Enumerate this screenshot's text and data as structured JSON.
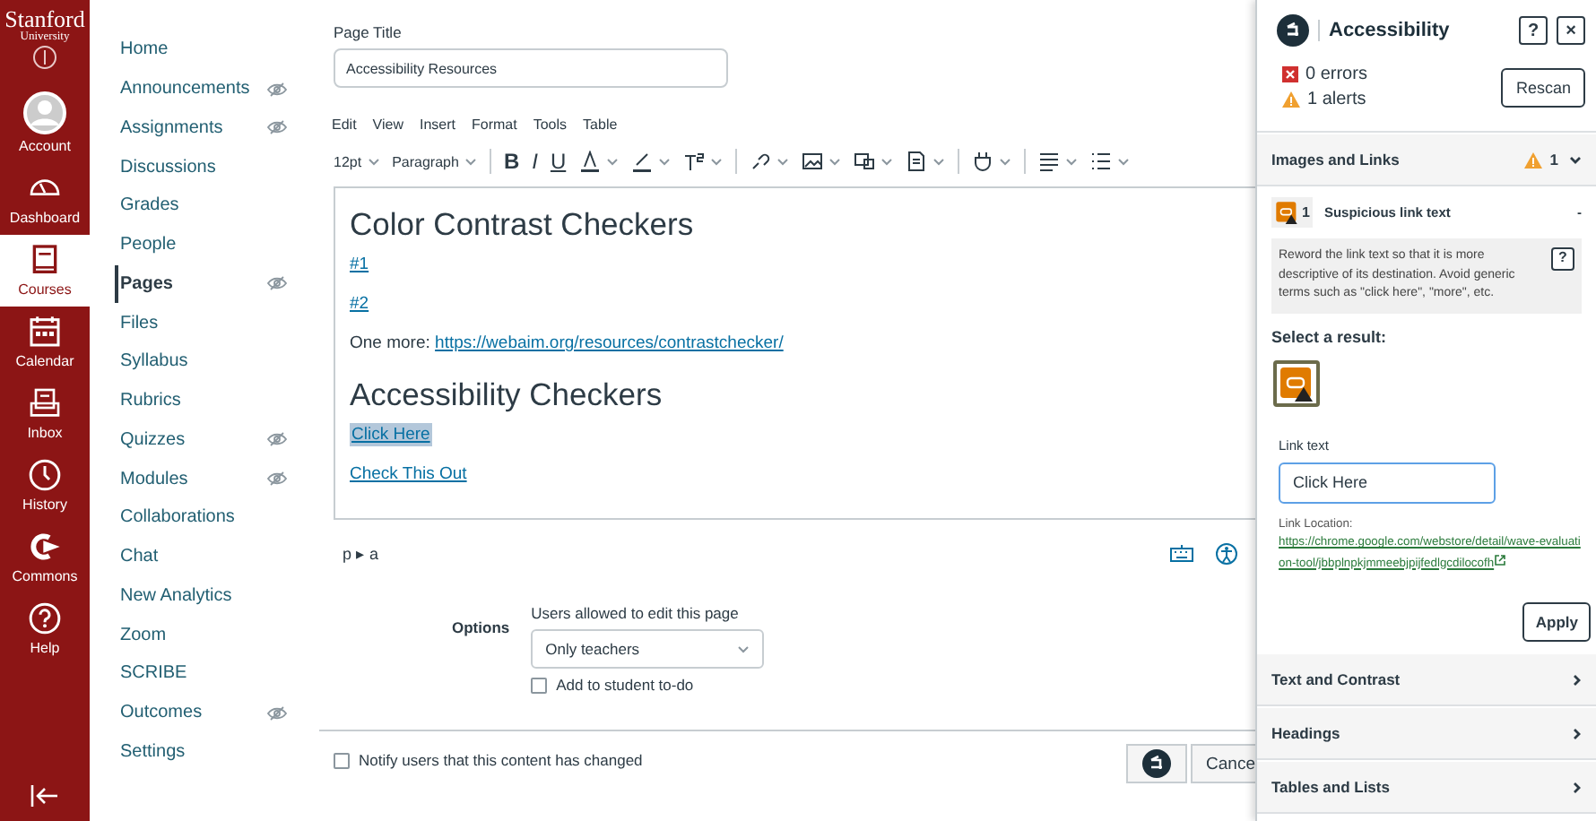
{
  "global_nav": {
    "logo": {
      "title": "Stanford",
      "subtitle": "University"
    },
    "items": [
      {
        "label": "Account",
        "selected": false
      },
      {
        "label": "Dashboard",
        "selected": false
      },
      {
        "label": "Courses",
        "selected": true
      },
      {
        "label": "Calendar",
        "selected": false
      },
      {
        "label": "Inbox",
        "selected": false
      },
      {
        "label": "History",
        "selected": false
      },
      {
        "label": "Commons",
        "selected": false
      },
      {
        "label": "Help",
        "selected": false
      }
    ]
  },
  "course_nav": {
    "items": [
      {
        "label": "Home",
        "hidden": false,
        "selected": false
      },
      {
        "label": "Announcements",
        "hidden": true,
        "selected": false
      },
      {
        "label": "Assignments",
        "hidden": true,
        "selected": false
      },
      {
        "label": "Discussions",
        "hidden": false,
        "selected": false
      },
      {
        "label": "Grades",
        "hidden": false,
        "selected": false
      },
      {
        "label": "People",
        "hidden": false,
        "selected": false
      },
      {
        "label": "Pages",
        "hidden": true,
        "selected": true
      },
      {
        "label": "Files",
        "hidden": false,
        "selected": false
      },
      {
        "label": "Syllabus",
        "hidden": false,
        "selected": false
      },
      {
        "label": "Rubrics",
        "hidden": false,
        "selected": false
      },
      {
        "label": "Quizzes",
        "hidden": true,
        "selected": false
      },
      {
        "label": "Modules",
        "hidden": true,
        "selected": false
      },
      {
        "label": "Collaborations",
        "hidden": false,
        "selected": false
      },
      {
        "label": "Chat",
        "hidden": false,
        "selected": false
      },
      {
        "label": "New Analytics",
        "hidden": false,
        "selected": false
      },
      {
        "label": "Zoom",
        "hidden": false,
        "selected": false
      },
      {
        "label": "SCRIBE",
        "hidden": false,
        "selected": false
      },
      {
        "label": "Outcomes",
        "hidden": true,
        "selected": false
      },
      {
        "label": "Settings",
        "hidden": false,
        "selected": false
      }
    ]
  },
  "editor": {
    "title_label": "Page Title",
    "title_value": "Accessibility Resources",
    "menu": [
      "Edit",
      "View",
      "Insert",
      "Format",
      "Tools",
      "Table"
    ],
    "font_size": "12pt",
    "block_format": "Paragraph",
    "format_buttons": [
      "B",
      "I",
      "U"
    ],
    "content": [
      {
        "kind": "heading",
        "text": "Color Contrast Checkers"
      },
      {
        "kind": "link",
        "text": "#1",
        "selected": false
      },
      {
        "kind": "link",
        "text": "#2",
        "selected": false
      },
      {
        "kind": "paragraph",
        "text": "One more: ",
        "link": "https://webaim.org/resources/contrastchecker/"
      },
      {
        "kind": "heading",
        "text": "Accessibility Checkers"
      },
      {
        "kind": "link",
        "text": "Click Here",
        "selected": true
      },
      {
        "kind": "link",
        "text": "Check This Out",
        "selected": false
      }
    ],
    "path": "p ▸ a"
  },
  "options": {
    "label": "Options",
    "permission_label": "Users allowed to edit this page",
    "permission_value": "Only teachers",
    "todo": {
      "label": "Add to student to-do",
      "checked": false
    }
  },
  "footer": {
    "notify": {
      "label": "Notify users that this content has changed",
      "checked": false
    },
    "cancel": "Cance"
  },
  "panel": {
    "title": "Accessibility",
    "help": "?",
    "close": "×",
    "errors": "0 errors",
    "alerts": "1 alerts",
    "rescan": "Rescan",
    "sections": [
      {
        "title": "Images and Links",
        "alert_count": "1",
        "expanded": true
      },
      {
        "title": "Text and Contrast",
        "expanded": false
      },
      {
        "title": "Headings",
        "expanded": false
      },
      {
        "title": "Tables and Lists",
        "expanded": false
      }
    ],
    "issue": {
      "count": "1",
      "label": "Suspicious link text",
      "toggle": "-",
      "description": "Reword the link text so that it is more descriptive of its destination. Avoid generic terms such as \"click here\", \"more\", etc.",
      "help": "?"
    },
    "select_label": "Select a result:",
    "link_text_label": "Link text",
    "link_text_value": "Click Here",
    "location_label": "Link Location:",
    "location_url": "https://chrome.google.com/webstore/detail/wave-evaluation-tool/jbbplnpkjmmeebjpijfedlgcdilocofh",
    "apply": "Apply"
  }
}
